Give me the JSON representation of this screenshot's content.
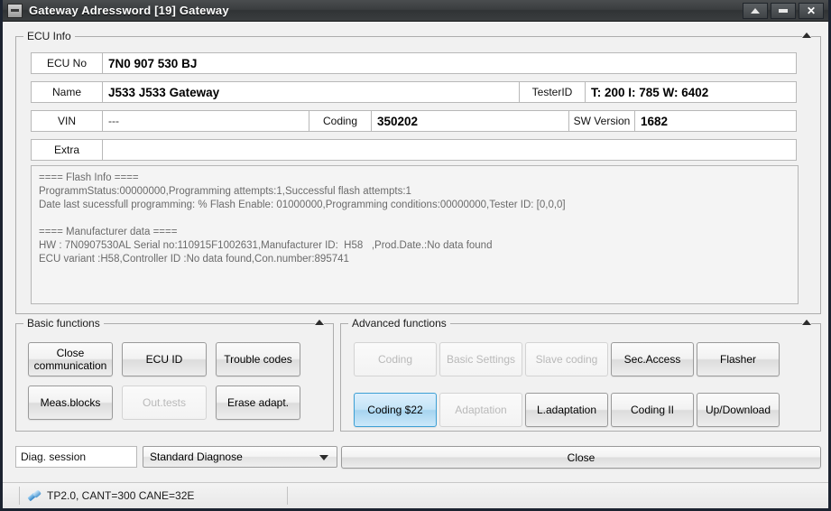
{
  "window": {
    "title": "Gateway Adressword [19] Gateway",
    "icon": "window-icon",
    "buttons": [
      {
        "name": "restore",
        "glyph": "up-triangle"
      },
      {
        "name": "minimize",
        "glyph": "dash"
      },
      {
        "name": "close",
        "glyph": "X"
      }
    ]
  },
  "ecu_info": {
    "legend": "ECU Info",
    "rows": [
      {
        "label": "ECU No",
        "value": "7N0 907 530 BJ"
      },
      {
        "label": "Name",
        "value": "J533 J533  Gateway",
        "label2": "TesterID",
        "value2": "T: 200 I: 785 W: 6402"
      },
      {
        "label": "VIN",
        "value": "---",
        "label2": "Coding",
        "value2": "350202",
        "label3": "SW Version",
        "value3": "1682"
      },
      {
        "label": "Extra",
        "value": ""
      }
    ],
    "flash_info": "==== Flash Info ====\nProgrammStatus:00000000,Programming attempts:1,Successful flash attempts:1\nDate last sucessfull programming: % Flash Enable: 01000000,Programming conditions:00000000,Tester ID: [0,0,0]\n\n==== Manufacturer data ====\nHW : 7N0907530AL Serial no:110915F1002631,Manufacturer ID:  H58   ,Prod.Date.:No data found\nECU variant :H58,Controller ID :No data found,Con.number:895741"
  },
  "basic_functions": {
    "legend": "Basic functions",
    "buttons": [
      {
        "label": "Close\ncommunication",
        "state": "enabled"
      },
      {
        "label": "ECU ID",
        "state": "enabled"
      },
      {
        "label": "Trouble codes",
        "state": "enabled"
      },
      {
        "label": "Meas.blocks",
        "state": "enabled"
      },
      {
        "label": "Out.tests",
        "state": "disabled"
      },
      {
        "label": "Erase adapt.",
        "state": "enabled"
      }
    ]
  },
  "advanced_functions": {
    "legend": "Advanced functions",
    "buttons": [
      {
        "label": "Coding",
        "state": "disabled"
      },
      {
        "label": "Basic Settings",
        "state": "disabled"
      },
      {
        "label": "Slave coding",
        "state": "disabled"
      },
      {
        "label": "Sec.Access",
        "state": "enabled"
      },
      {
        "label": "Flasher",
        "state": "enabled"
      },
      {
        "label": "Coding $22",
        "state": "highlight"
      },
      {
        "label": "Adaptation",
        "state": "disabled"
      },
      {
        "label": "L.adaptation",
        "state": "enabled"
      },
      {
        "label": "Coding II",
        "state": "enabled"
      },
      {
        "label": "Up/Download",
        "state": "enabled"
      }
    ]
  },
  "bottom_bar": {
    "diag_session_label": "Diag. session",
    "session_selected": "Standard Diagnose",
    "close_label": "Close"
  },
  "status_bar": {
    "icon": "plug-icon",
    "text": "TP2.0, CANT=300 CANE=32E"
  },
  "colors": {
    "titlebar": "#3b3e40",
    "window_bg": "#f1f1f1",
    "highlight_border": "#3c9fd4",
    "highlight_fill": "#a6d4ef",
    "disabled_text": "#b9b9b9"
  }
}
